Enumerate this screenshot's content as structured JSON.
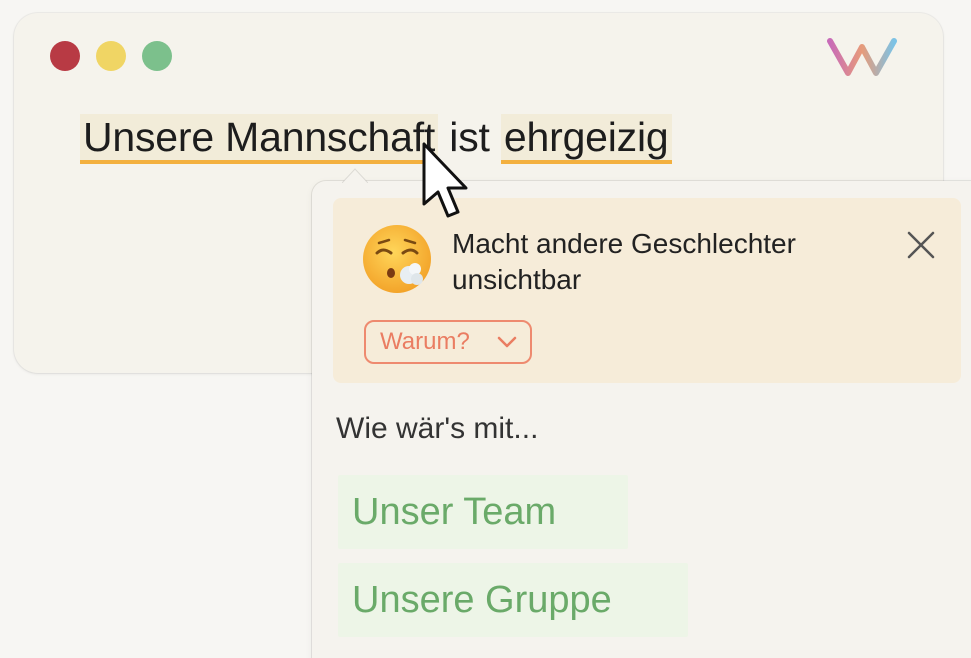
{
  "window": {
    "traffic_lights": [
      "close",
      "minimize",
      "maximize"
    ],
    "logo_icon": "wordflow-logo-icon"
  },
  "editor": {
    "words": [
      "Unsere Mannschaft",
      " ist ",
      "ehrgeizig"
    ]
  },
  "popup": {
    "warning_title": "Macht andere Geschlechter unsichtbar",
    "emoji": "😮‍💨",
    "why_label": "Warum?",
    "suggestion_intro": "Wie wär's mit...",
    "suggestions": [
      "Unser Team",
      "Unsere Gruppe"
    ]
  },
  "colors": {
    "highlight_underline": "#f3b03f",
    "warning_bg": "#f6ecd9",
    "why_border": "#ee8a6f",
    "suggestion_bg": "#edf5e7",
    "suggestion_text": "#6aaa69"
  }
}
